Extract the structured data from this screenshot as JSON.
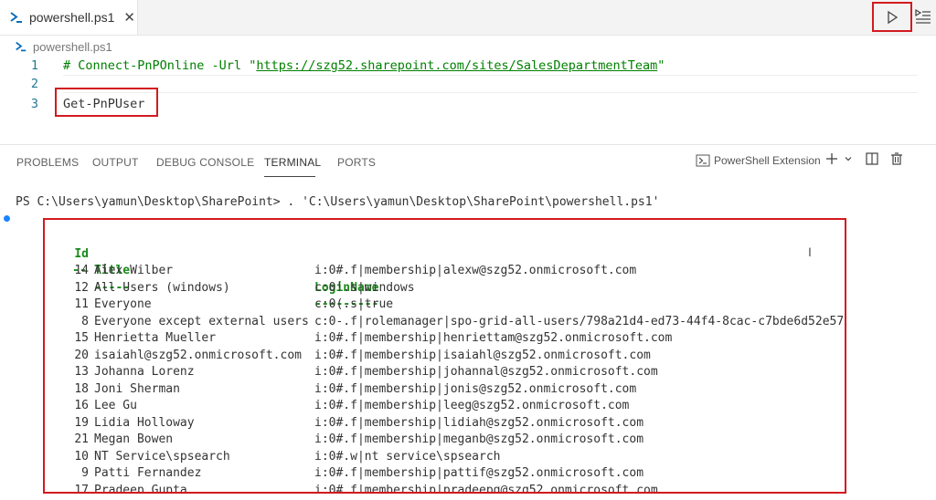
{
  "editor_tab": {
    "label": "powershell.ps1",
    "close": "✕"
  },
  "breadcrumb": {
    "label": "powershell.ps1"
  },
  "code_lines": [
    {
      "num": "1",
      "prefix": "# Connect-PnPOnline -Url \"",
      "url": "https://szg52.sharepoint.com/sites/SalesDepartmentTeam",
      "suffix": "\""
    },
    {
      "num": "2",
      "text": ""
    },
    {
      "num": "3",
      "text": "Get-PnPUser"
    }
  ],
  "panel_tabs": [
    "PROBLEMS",
    "OUTPUT",
    "DEBUG CONSOLE",
    "TERMINAL",
    "PORTS"
  ],
  "active_panel_tab": "TERMINAL",
  "terminal_profile": "PowerShell Extension",
  "terminal": {
    "prompt": "PS C:\\Users\\yamun\\Desktop\\SharePoint> . 'C:\\Users\\yamun\\Desktop\\SharePoint\\powershell.ps1'",
    "headers": {
      "id": "Id",
      "title": "Title",
      "login": "LoginName"
    },
    "dashes": {
      "id": "--",
      "title": "-----",
      "login": "---------"
    },
    "rows": [
      {
        "id": "14",
        "title": "Alex Wilber",
        "login": "i:0#.f|membership|alexw@szg52.onmicrosoft.com"
      },
      {
        "id": "12",
        "title": "All Users (windows)",
        "login": "c:0!.s|windows"
      },
      {
        "id": "11",
        "title": "Everyone",
        "login": "c:0(.s|true"
      },
      {
        "id": "8",
        "title": "Everyone except external users",
        "login": "c:0-.f|rolemanager|spo-grid-all-users/798a21d4-ed73-44f4-8cac-c7bde6d52e57"
      },
      {
        "id": "15",
        "title": "Henrietta Mueller",
        "login": "i:0#.f|membership|henriettam@szg52.onmicrosoft.com"
      },
      {
        "id": "20",
        "title": "isaiahl@szg52.onmicrosoft.com",
        "login": "i:0#.f|membership|isaiahl@szg52.onmicrosoft.com"
      },
      {
        "id": "13",
        "title": "Johanna Lorenz",
        "login": "i:0#.f|membership|johannal@szg52.onmicrosoft.com"
      },
      {
        "id": "18",
        "title": "Joni Sherman",
        "login": "i:0#.f|membership|jonis@szg52.onmicrosoft.com"
      },
      {
        "id": "16",
        "title": "Lee Gu",
        "login": "i:0#.f|membership|leeg@szg52.onmicrosoft.com"
      },
      {
        "id": "19",
        "title": "Lidia Holloway",
        "login": "i:0#.f|membership|lidiah@szg52.onmicrosoft.com"
      },
      {
        "id": "21",
        "title": "Megan Bowen",
        "login": "i:0#.f|membership|meganb@szg52.onmicrosoft.com"
      },
      {
        "id": "10",
        "title": "NT Service\\spsearch",
        "login": "i:0#.w|nt service\\spsearch"
      },
      {
        "id": "9",
        "title": "Patti Fernandez",
        "login": "i:0#.f|membership|pattif@szg52.onmicrosoft.com"
      },
      {
        "id": "17",
        "title": "Pradeep Gupta",
        "login": "i:0#.f|membership|pradeepg@szg52.onmicrosoft.com"
      }
    ]
  },
  "icons": {
    "run": "play-icon",
    "more": "run-menu-icon",
    "ps": "powershell-icon",
    "add": "plus-icon",
    "split": "split-terminal-icon",
    "trash": "trash-icon"
  },
  "colors": {
    "highlight": "#d21a1f",
    "comment": "#008000",
    "header": "#1a8a1a",
    "line_number": "#237893",
    "ps_blue": "#0a6ebd"
  }
}
